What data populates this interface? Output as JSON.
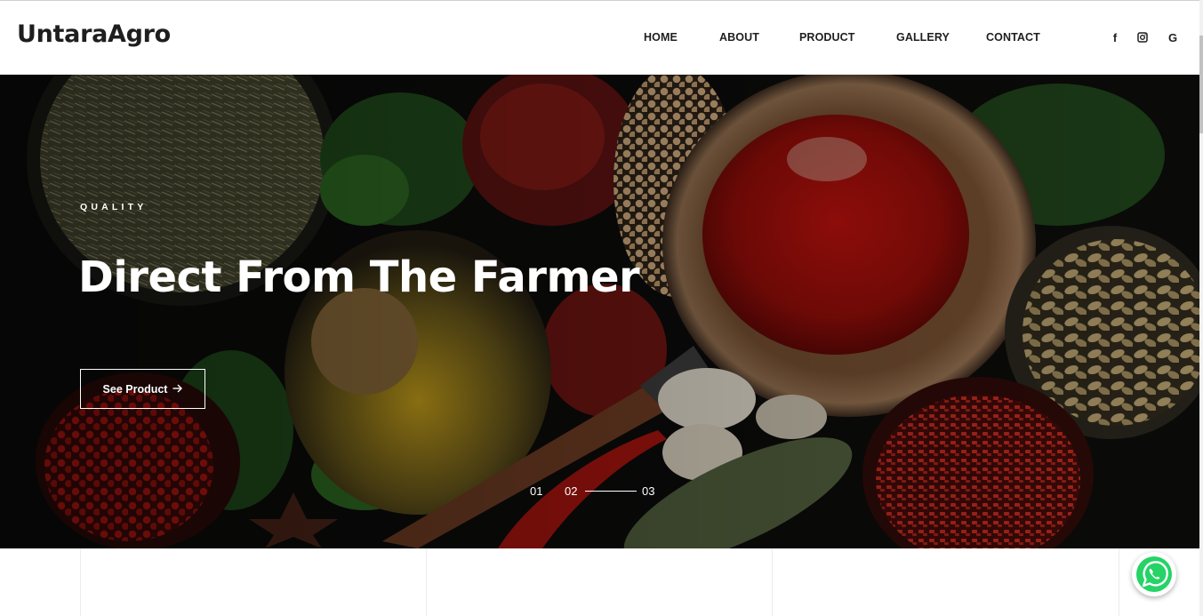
{
  "header": {
    "logo": "UntaraAgro",
    "nav": [
      {
        "label": "HOME"
      },
      {
        "label": "ABOUT"
      },
      {
        "label": "PRODUCT"
      },
      {
        "label": "GALLERY"
      },
      {
        "label": "CONTACT"
      }
    ],
    "social": [
      {
        "icon": "facebook-icon",
        "glyph": "f"
      },
      {
        "icon": "instagram-icon",
        "glyph": ""
      },
      {
        "icon": "google-icon",
        "glyph": "G"
      }
    ]
  },
  "hero": {
    "eyebrow": "QUALITY",
    "headline": "Direct From The Farmer",
    "cta_label": "See Product",
    "cta_icon": "arrow-right-icon",
    "slides": [
      "01",
      "02",
      "03"
    ],
    "active_slide": "02"
  },
  "floating": {
    "whatsapp_icon": "whatsapp-icon",
    "whatsapp_color": "#25D366"
  },
  "colors": {
    "text_dark": "#1f1f1f",
    "hero_text": "#ffffff"
  }
}
